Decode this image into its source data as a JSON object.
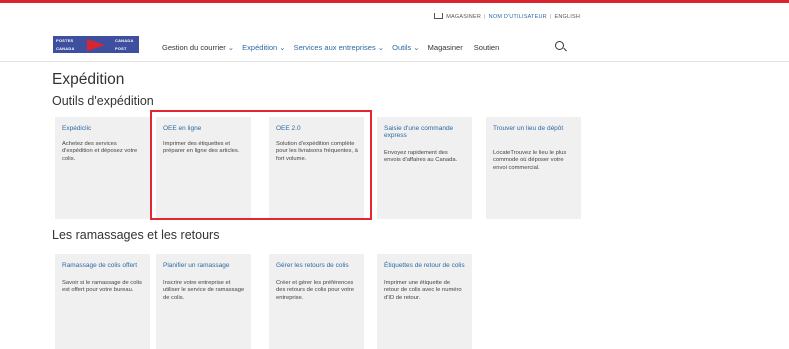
{
  "utility": {
    "shop": "MAGASINER",
    "username": "NOM D'UTILISATEUR",
    "language": "ENGLISH"
  },
  "logo": {
    "line1": "POSTES",
    "line2": "CANADA",
    "line3": "CANADA",
    "line4": "POST"
  },
  "nav": {
    "items": [
      "Gestion du courrier",
      "Expédition",
      "Services aux entreprises",
      "Outils",
      "Magasiner",
      "Soutien"
    ]
  },
  "page": {
    "title": "Expédition",
    "section1": "Outils d'expédition",
    "section2": "Les ramassages et les retours"
  },
  "tools": [
    {
      "title": "Expédiclic",
      "desc": "Achetez des services d'expédition et déposez votre colis."
    },
    {
      "title": "OEE en ligne",
      "desc": "Imprimer des étiquettes et préparer en ligne des articles."
    },
    {
      "title": "OEE 2.0",
      "desc": "Solution d'expédition complète pour les livraisons fréquentes, à fort volume."
    },
    {
      "title": "Saisie d'une commande express",
      "desc": "Envoyez rapidement des envois d'affaires au Canada."
    },
    {
      "title": "Trouver un lieu de dépôt",
      "desc": "LocateTrouvez le lieu le plus commode où déposer votre envoi commercial."
    }
  ],
  "pickups": [
    {
      "title": "Ramassage de colis offert",
      "desc": "Savoir si le ramassage de colis est offert pour votre bureau."
    },
    {
      "title": "Planifier un ramassage",
      "desc": "Inscrire votre entreprise et utiliser le service de ramassage de colis."
    },
    {
      "title": "Gérer les retours de colis",
      "desc": "Créer et gérer les préférences des retours de colis pour votre entreprise."
    },
    {
      "title": "Étiquettes de retour de colis",
      "desc": "Imprimer une étiquette de retour de colis avec le numéro d'ID de retour."
    }
  ],
  "colors": {
    "accent": "#d9262e",
    "link": "#2d6aa3",
    "card": "#f0f0f0",
    "highlight": "#e52631"
  }
}
